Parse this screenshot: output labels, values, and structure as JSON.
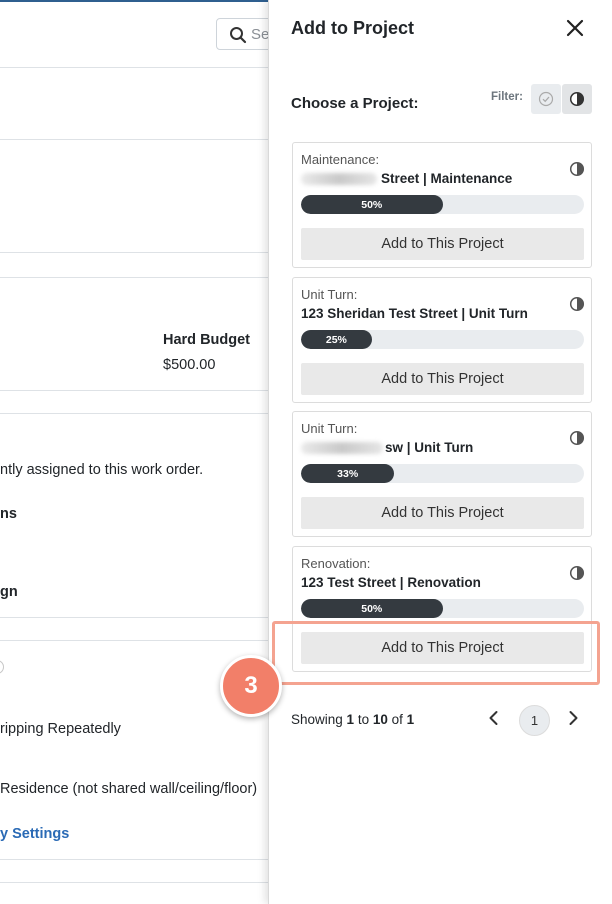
{
  "background": {
    "search_placeholder": "Se",
    "hard_budget_label": "Hard Budget",
    "hard_budget_value": "$500.00",
    "assigned_text": "ntly assigned to this work order.",
    "line_ns": "ns",
    "line_gn": "gn",
    "tripping_text": "ripping Repeatedly",
    "residence_text": "Residence (not shared wall/ceiling/floor)",
    "settings_link": "y Settings"
  },
  "drawer": {
    "title": "Add to Project",
    "choose_label": "Choose a Project:",
    "filter_label": "Filter:"
  },
  "projects": [
    {
      "type": "Maintenance:",
      "name": "Street | Maintenance",
      "progress_pct": 50,
      "progress_label": "50%",
      "button": "Add to This Project"
    },
    {
      "type": "Unit Turn:",
      "name": "123 Sheridan Test Street | Unit Turn",
      "progress_pct": 25,
      "progress_label": "25%",
      "button": "Add to This Project"
    },
    {
      "type": "Unit Turn:",
      "name": "sw | Unit Turn",
      "progress_pct": 33,
      "progress_label": "33%",
      "button": "Add to This Project"
    },
    {
      "type": "Renovation:",
      "name": "123 Test Street | Renovation",
      "progress_pct": 50,
      "progress_label": "50%",
      "button": "Add to This Project"
    }
  ],
  "step_badge": "3",
  "pagination": {
    "showing_prefix": "Showing ",
    "from": "1",
    "to_word": " to ",
    "to": "10",
    "of_word": " of ",
    "total": "1",
    "current_page": "1"
  },
  "colors": {
    "accent": "#f27f69",
    "highlight": "#f4a390",
    "progress": "#343a40",
    "link": "#2a6ab5"
  }
}
